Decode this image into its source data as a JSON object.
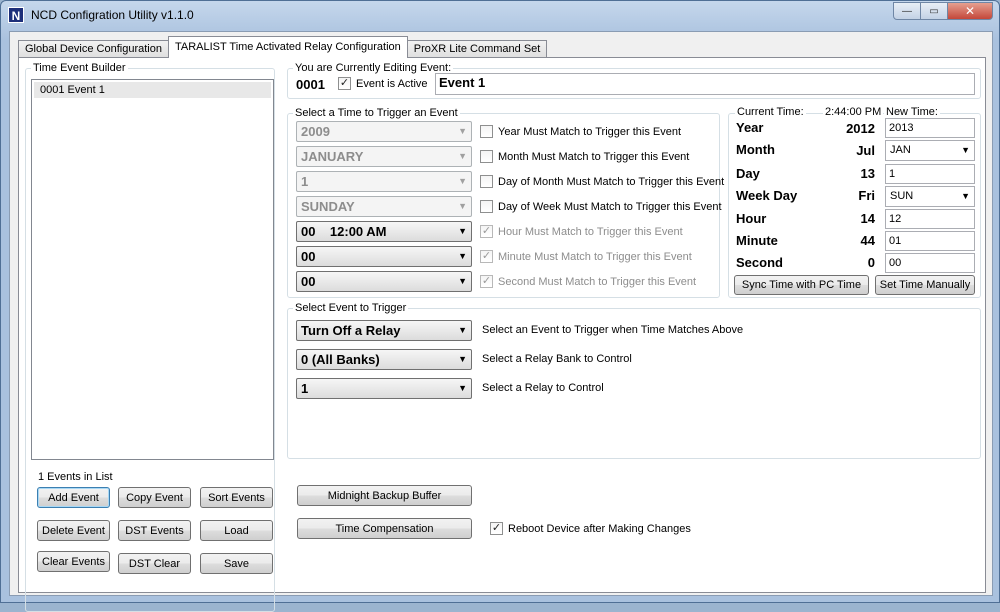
{
  "window": {
    "title": "NCD Configration Utility    v1.1.0",
    "icon_letter": "N",
    "min_label": "—",
    "max_label": "▭",
    "close_label": "✕"
  },
  "tabs": [
    {
      "label": "Global Device Configuration"
    },
    {
      "label": "TARALIST Time Activated Relay Configuration"
    },
    {
      "label": "ProXR Lite Command Set"
    }
  ],
  "builder": {
    "group_label": "Time Event Builder",
    "items": [
      "0001 Event 1"
    ],
    "count_label": "1 Events in List",
    "buttons": {
      "add": "Add Event",
      "copy": "Copy Event",
      "sort": "Sort Events",
      "delete": "Delete Event",
      "dst_events": "DST Events",
      "load": "Load",
      "clear": "Clear Events",
      "dst_clear": "DST Clear",
      "save": "Save"
    }
  },
  "editing": {
    "group_label": "You are Currently Editing Event:",
    "number": "0001",
    "active_label": "Event is Active",
    "active_checked": "✓",
    "name": "Event 1"
  },
  "trigger_time": {
    "group_label": "Select a Time to Trigger an Event",
    "year": "2009",
    "month": "JANUARY",
    "day": "1",
    "weekday": "SUNDAY",
    "hour": "00    12:00 AM",
    "minute": "00",
    "second": "00",
    "year_match": "Year Must Match to Trigger this Event",
    "month_match": "Month Must Match to Trigger this Event",
    "day_match": "Day of Month Must Match to Trigger this Event",
    "weekday_match": "Day of Week Must Match to Trigger this Event",
    "hour_match": "Hour Must Match to Trigger this Event",
    "minute_match": "Minute Must Match to Trigger this Event",
    "second_match": "Second Must Match to Trigger this Event",
    "check_mark": "✓"
  },
  "clock": {
    "current_label": "Current Time:",
    "current_time": "2:44:00 PM",
    "new_label": "New Time:",
    "rows": {
      "year": {
        "label": "Year",
        "value": "2012",
        "new": "2013"
      },
      "month": {
        "label": "Month",
        "value": "Jul",
        "new": "JAN"
      },
      "day": {
        "label": "Day",
        "value": "13",
        "new": "1"
      },
      "weekday": {
        "label": "Week Day",
        "value": "Fri",
        "new": "SUN"
      },
      "hour": {
        "label": "Hour",
        "value": "14",
        "new": "12"
      },
      "minute": {
        "label": "Minute",
        "value": "44",
        "new": "01"
      },
      "second": {
        "label": "Second",
        "value": "0",
        "new": "00"
      }
    },
    "sync_button": "Sync Time with PC Time",
    "set_button": "Set Time Manually"
  },
  "event_trigger": {
    "group_label": "Select Event to Trigger",
    "action": "Turn Off a Relay",
    "action_help": "Select an Event to Trigger when Time Matches Above",
    "bank": "0 (All Banks)",
    "bank_help": "Select a Relay Bank to Control",
    "relay": "1",
    "relay_help": "Select a Relay to Control"
  },
  "bottom": {
    "midnight_button": "Midnight Backup Buffer",
    "time_comp_button": "Time Compensation",
    "reboot_label": "Reboot Device after Making Changes",
    "reboot_checked": "✓"
  },
  "icons": {
    "dropdown_arrow": "▼"
  }
}
